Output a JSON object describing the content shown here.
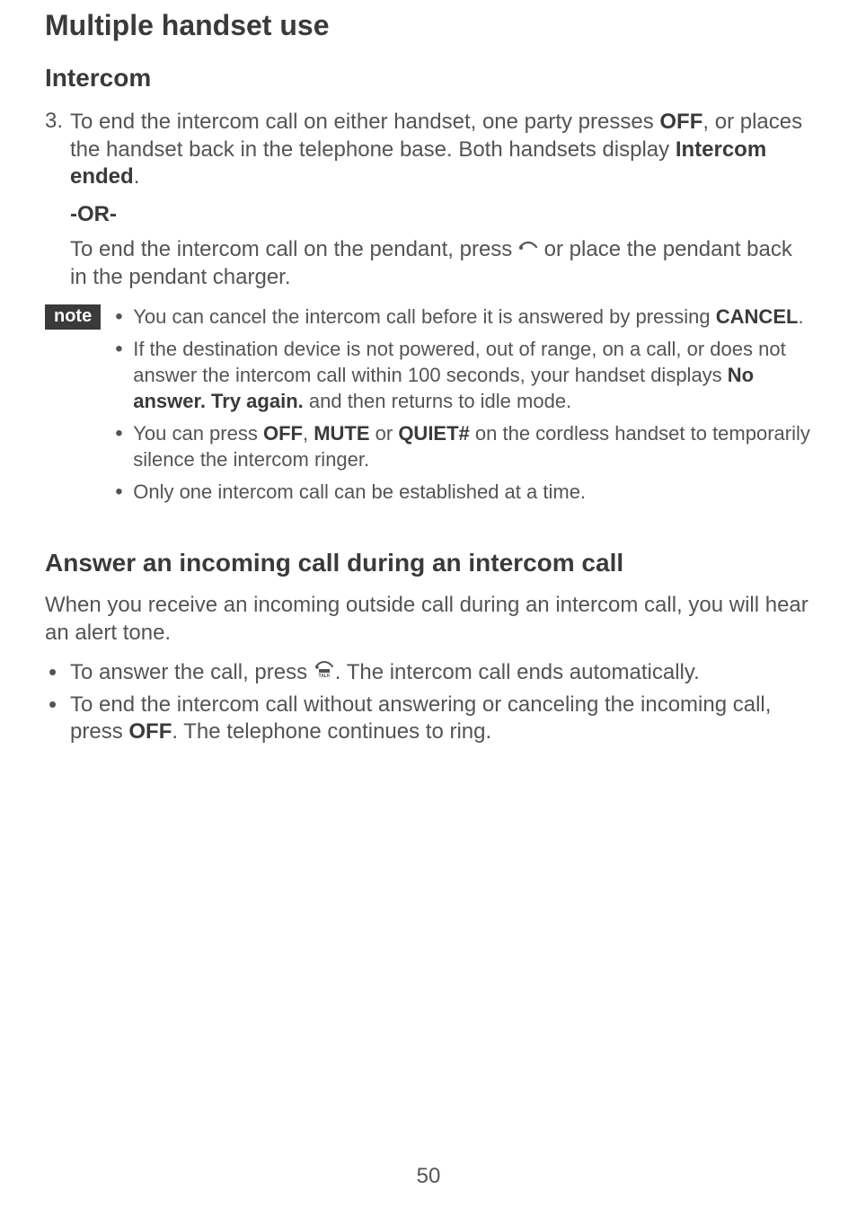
{
  "page_title": "Multiple handset use",
  "section1": {
    "title": "Intercom",
    "step3": {
      "number": "3.",
      "text_a": "To end the intercom call on either handset, one party presses ",
      "off": "OFF",
      "text_b": ", or places the handset back in the telephone base. Both handsets display ",
      "intercom_ended": "Intercom ended",
      "text_c": "."
    },
    "or_label": "-OR-",
    "pendant_para": {
      "text_a": "To end the intercom call on the pendant, press ",
      "text_b": " or place the pendant back in the pendant charger."
    },
    "note_badge": "note",
    "notes": {
      "n1": {
        "text_a": "You can cancel the intercom call before it is answered by pressing ",
        "cancel": "CANCEL",
        "text_b": "."
      },
      "n2": {
        "text_a": "If the destination device is not powered, out of range, on a call, or does not answer the intercom call within 100 seconds, your handset displays ",
        "noanswer": "No answer. Try again.",
        "text_b": " and then returns to idle mode."
      },
      "n3": {
        "text_a": "You can press ",
        "off": "OFF",
        "comma1": ", ",
        "mute": "MUTE",
        "or": " or ",
        "quiet": "QUIET#",
        "text_b": " on the cordless handset to temporarily silence the intercom ringer."
      },
      "n4": "Only one intercom call can be established at a time."
    }
  },
  "section2": {
    "title": "Answer an incoming call during an intercom call",
    "intro": "When you receive an incoming outside call during an intercom call, you will hear an alert tone.",
    "b1": {
      "text_a": "To answer the call, press ",
      "text_b": ". The intercom call ends automatically."
    },
    "b2": {
      "text_a": "To end the intercom call without answering or canceling the incoming call, press ",
      "off": "OFF",
      "text_b": ". The telephone continues to ring."
    }
  },
  "page_number": "50"
}
